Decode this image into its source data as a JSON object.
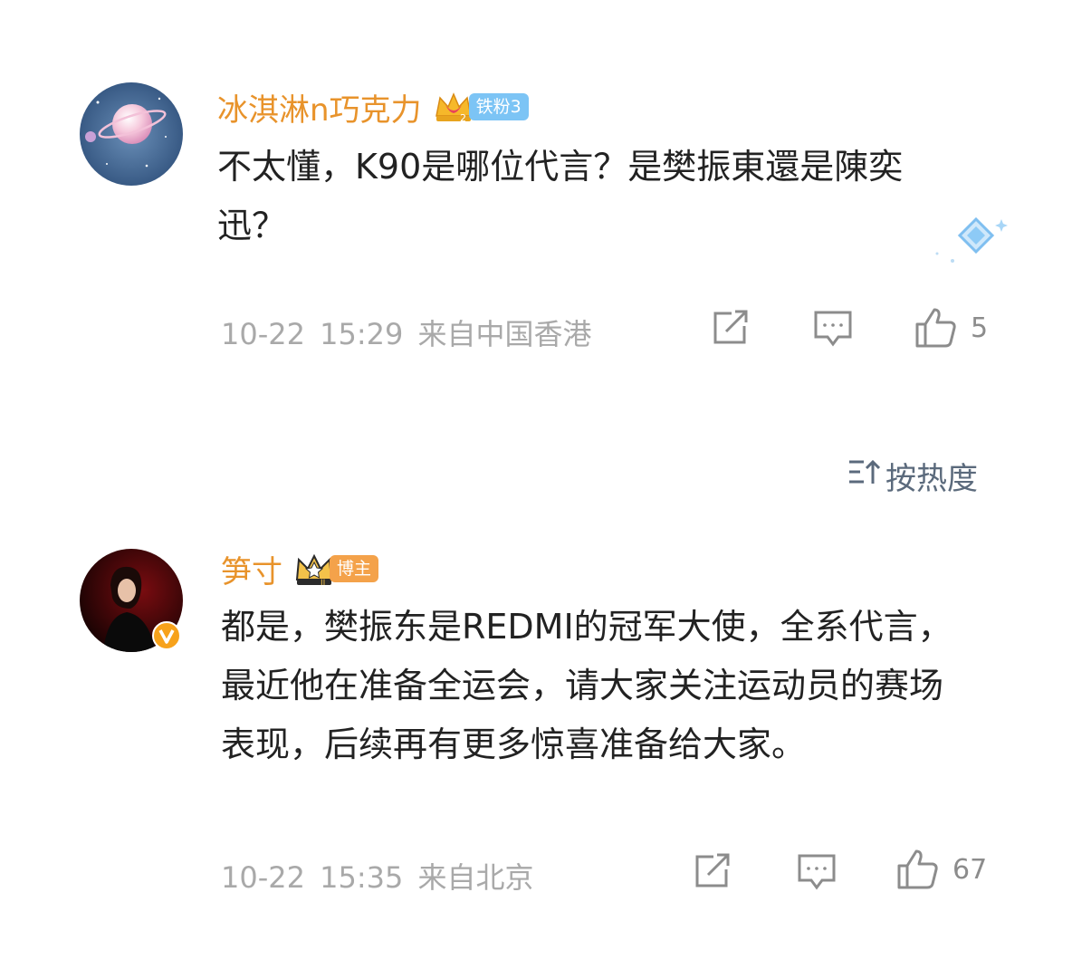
{
  "comments": [
    {
      "username": "冰淇淋n巧克力",
      "badge": {
        "crown_level": "2",
        "label": "铁粉3",
        "color": "#7cc4f5"
      },
      "content": "不太懂，K90是哪位代言？是樊振東還是陳奕迅？",
      "meta": "10-22 15:29  来自中国香港",
      "likes": "5"
    },
    {
      "username": "笋寸",
      "badge": {
        "crown_level": "II",
        "label": "博主",
        "color": "#f4a24a"
      },
      "content": "都是，樊振东是REDMI的冠军大使，全系代言，最近他在准备全运会，请大家关注运动员的赛场表现，后续再有更多惊喜准备给大家。",
      "meta": "10-22 15:35  来自北京",
      "likes": "67"
    }
  ],
  "sort": {
    "label": "按热度"
  },
  "icons": {
    "share": "share-icon",
    "reply": "comment-icon",
    "like": "thumbs-up-icon",
    "sort": "sort-icon",
    "verified": "verified-v-icon"
  },
  "colors": {
    "username": "#e8932b",
    "meta": "#a9a9a9",
    "sort": "#5b6a7c"
  }
}
